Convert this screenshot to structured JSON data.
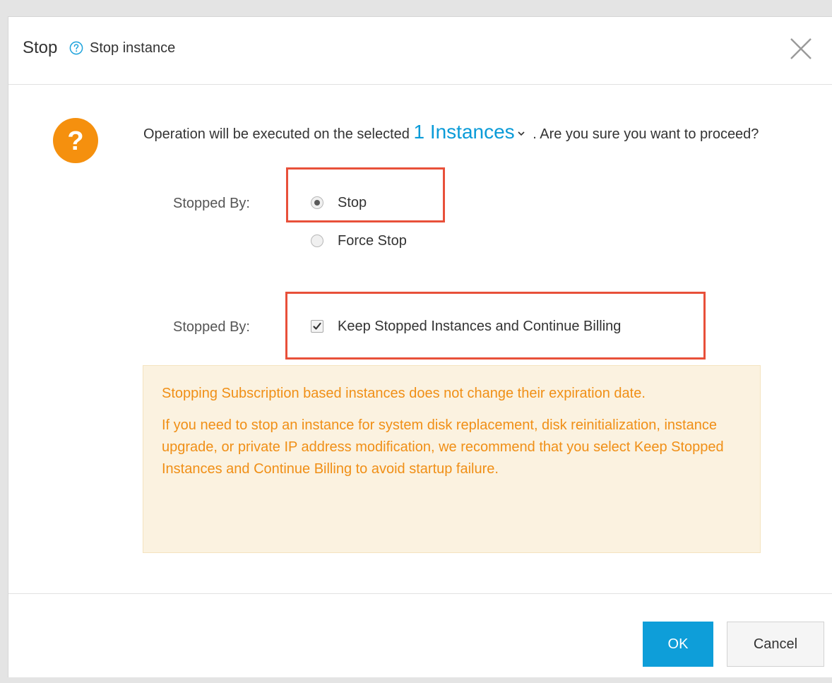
{
  "dialog": {
    "title": "Stop",
    "subtitle": "Stop instance"
  },
  "message": {
    "prefix": "Operation will be executed on the selected",
    "instances_link": "1 Instances",
    "suffix": ". Are you sure you want to proceed?"
  },
  "stop_mode": {
    "label": "Stopped By:",
    "options": [
      {
        "label": "Stop",
        "checked": true
      },
      {
        "label": "Force Stop",
        "checked": false
      }
    ]
  },
  "billing": {
    "label": "Stopped By:",
    "checkbox_label": "Keep Stopped Instances and Continue Billing",
    "checked": true
  },
  "notice": {
    "line1": "Stopping Subscription based instances does not change their expiration date.",
    "line2": "If you need to stop an instance for system disk replacement, disk reinitialization, instance upgrade, or private IP address modification, we recommend that you select Keep Stopped Instances and Continue Billing to avoid startup failure."
  },
  "buttons": {
    "ok": "OK",
    "cancel": "Cancel"
  },
  "colors": {
    "accent": "#0e9ed9",
    "link": "#0a9bd8",
    "warning_icon": "#f5900e",
    "notice_text": "#f08f16",
    "notice_bg": "#fbf2e0",
    "highlight": "#e8503a"
  },
  "icons": {
    "help": "question-circle-icon",
    "close": "close-icon",
    "warning": "question-mark-icon",
    "dropdown": "chevron-down-icon",
    "check": "check-icon"
  }
}
